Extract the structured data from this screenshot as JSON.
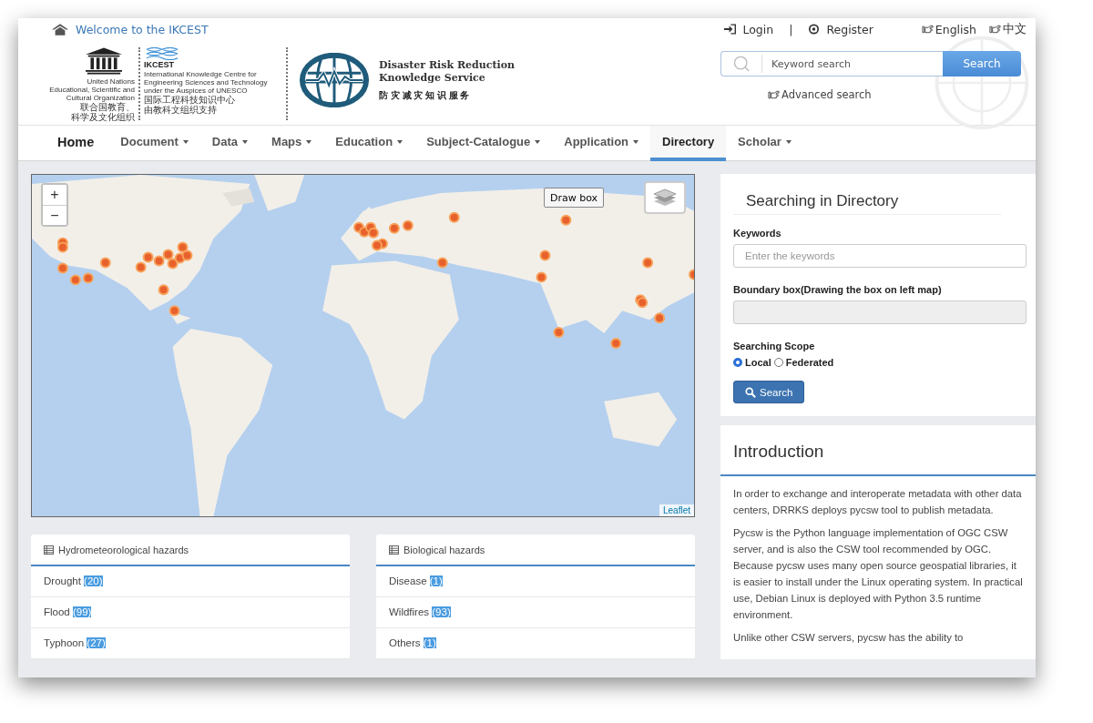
{
  "header": {
    "welcome": "Welcome to the IKCEST",
    "login": "Login",
    "separator": "|",
    "register": "Register",
    "languages": [
      {
        "label": "English"
      },
      {
        "label": "中文"
      }
    ]
  },
  "logos": {
    "unesco_lines": [
      "United Nations",
      "Educational, Scientific and",
      "Cultural Organization"
    ],
    "unesco_chinese": [
      "联合国教育、",
      "科学及文化组织"
    ],
    "ikcest_name": "IKCEST",
    "ikcest_lines": [
      "International Knowledge Centre for",
      "Engineering Sciences and Technology",
      "under the Auspices of UNESCO"
    ],
    "ikcest_chinese": [
      "国际工程科技知识中心",
      "由教科文组织支持"
    ],
    "service_title": [
      "Disaster Risk Reduction",
      "Knowledge Service"
    ],
    "service_chinese": "防 灾 减 灾 知 识 服 务"
  },
  "search": {
    "placeholder": "Keyword search",
    "button": "Search",
    "advanced": "Advanced search"
  },
  "nav": [
    {
      "label": "Home",
      "kind": "home",
      "dropdown": false,
      "selected": false
    },
    {
      "label": "Document",
      "kind": "menu",
      "dropdown": true,
      "selected": false
    },
    {
      "label": "Data",
      "kind": "menu",
      "dropdown": true,
      "selected": false
    },
    {
      "label": "Maps",
      "kind": "menu",
      "dropdown": true,
      "selected": false
    },
    {
      "label": "Education",
      "kind": "menu",
      "dropdown": true,
      "selected": false
    },
    {
      "label": "Subject-Catalogue",
      "kind": "menu",
      "dropdown": true,
      "selected": false
    },
    {
      "label": "Application",
      "kind": "menu",
      "dropdown": true,
      "selected": false
    },
    {
      "label": "Directory",
      "kind": "menu",
      "dropdown": false,
      "selected": true
    },
    {
      "label": "Scholar",
      "kind": "menu",
      "dropdown": true,
      "selected": false
    }
  ],
  "map": {
    "zoom_in": "+",
    "zoom_out": "−",
    "draw_box": "Draw box",
    "attribution": "Leaflet"
  },
  "categories": [
    {
      "title": "Hydrometeorological hazards",
      "items": [
        {
          "name": "Drought",
          "count": "(20)"
        },
        {
          "name": "Flood",
          "count": "(99)"
        },
        {
          "name": "Typhoon",
          "count": "(27)"
        }
      ]
    },
    {
      "title": "Biological hazards",
      "items": [
        {
          "name": "Disease",
          "count": "(1)"
        },
        {
          "name": "Wildfires",
          "count": "(93)"
        },
        {
          "name": "Others",
          "count": "(1)"
        }
      ]
    }
  ],
  "directory_search": {
    "title": "Searching in Directory",
    "keywords_label": "Keywords",
    "keywords_placeholder": "Enter the keywords",
    "bbox_label": "Boundary box(Drawing the box on left map)",
    "scope_label": "Searching Scope",
    "scopes": [
      {
        "label": "Local",
        "selected": true
      },
      {
        "label": "Federated",
        "selected": false
      }
    ],
    "button": "Search"
  },
  "introduction": {
    "title": "Introduction",
    "paragraphs": [
      "In order to exchange and interoperate metadata with other data centers, DRRKS deploys pycsw tool to publish metadata.",
      "Pycsw is the Python language implementation of OGC CSW server, and is also the CSW tool recommended by OGC. Because pycsw uses many open source geospatial libraries, it is easier to install under the Linux operating system. In practical use, Debian Linux is deployed with Python 3.5 runtime environment.",
      "Unlike other CSW servers, pycsw has the ability to"
    ]
  }
}
